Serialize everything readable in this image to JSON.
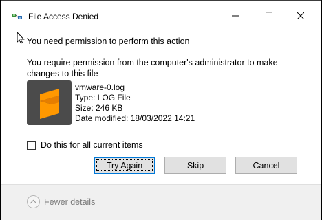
{
  "window": {
    "title": "File Access Denied",
    "title_icon": "file-copy-icon"
  },
  "window_controls": {
    "minimize_icon": "minimize-icon",
    "maximize_icon": "maximize-icon",
    "close_icon": "close-icon"
  },
  "main": {
    "heading": "You need permission to perform this action",
    "description": "You require permission from the computer's administrator to make changes to this file"
  },
  "file": {
    "icon": "sublime-text-icon",
    "icon_bg_color": "#4b4b4b",
    "icon_accent_color": "#ff9800",
    "name": "vmware-0.log",
    "type": "Type: LOG File",
    "size": "Size: 246 KB",
    "modified": "Date modified: 18/03/2022 14:21"
  },
  "checkbox": {
    "label": "Do this for all current items",
    "checked": false
  },
  "buttons": {
    "try_again": "Try Again",
    "skip": "Skip",
    "cancel": "Cancel"
  },
  "footer": {
    "fewer_details": "Fewer details",
    "icon": "chevron-up-icon"
  },
  "colors": {
    "focus_border": "#0078d7",
    "footer_bg": "#f0f0f0"
  }
}
